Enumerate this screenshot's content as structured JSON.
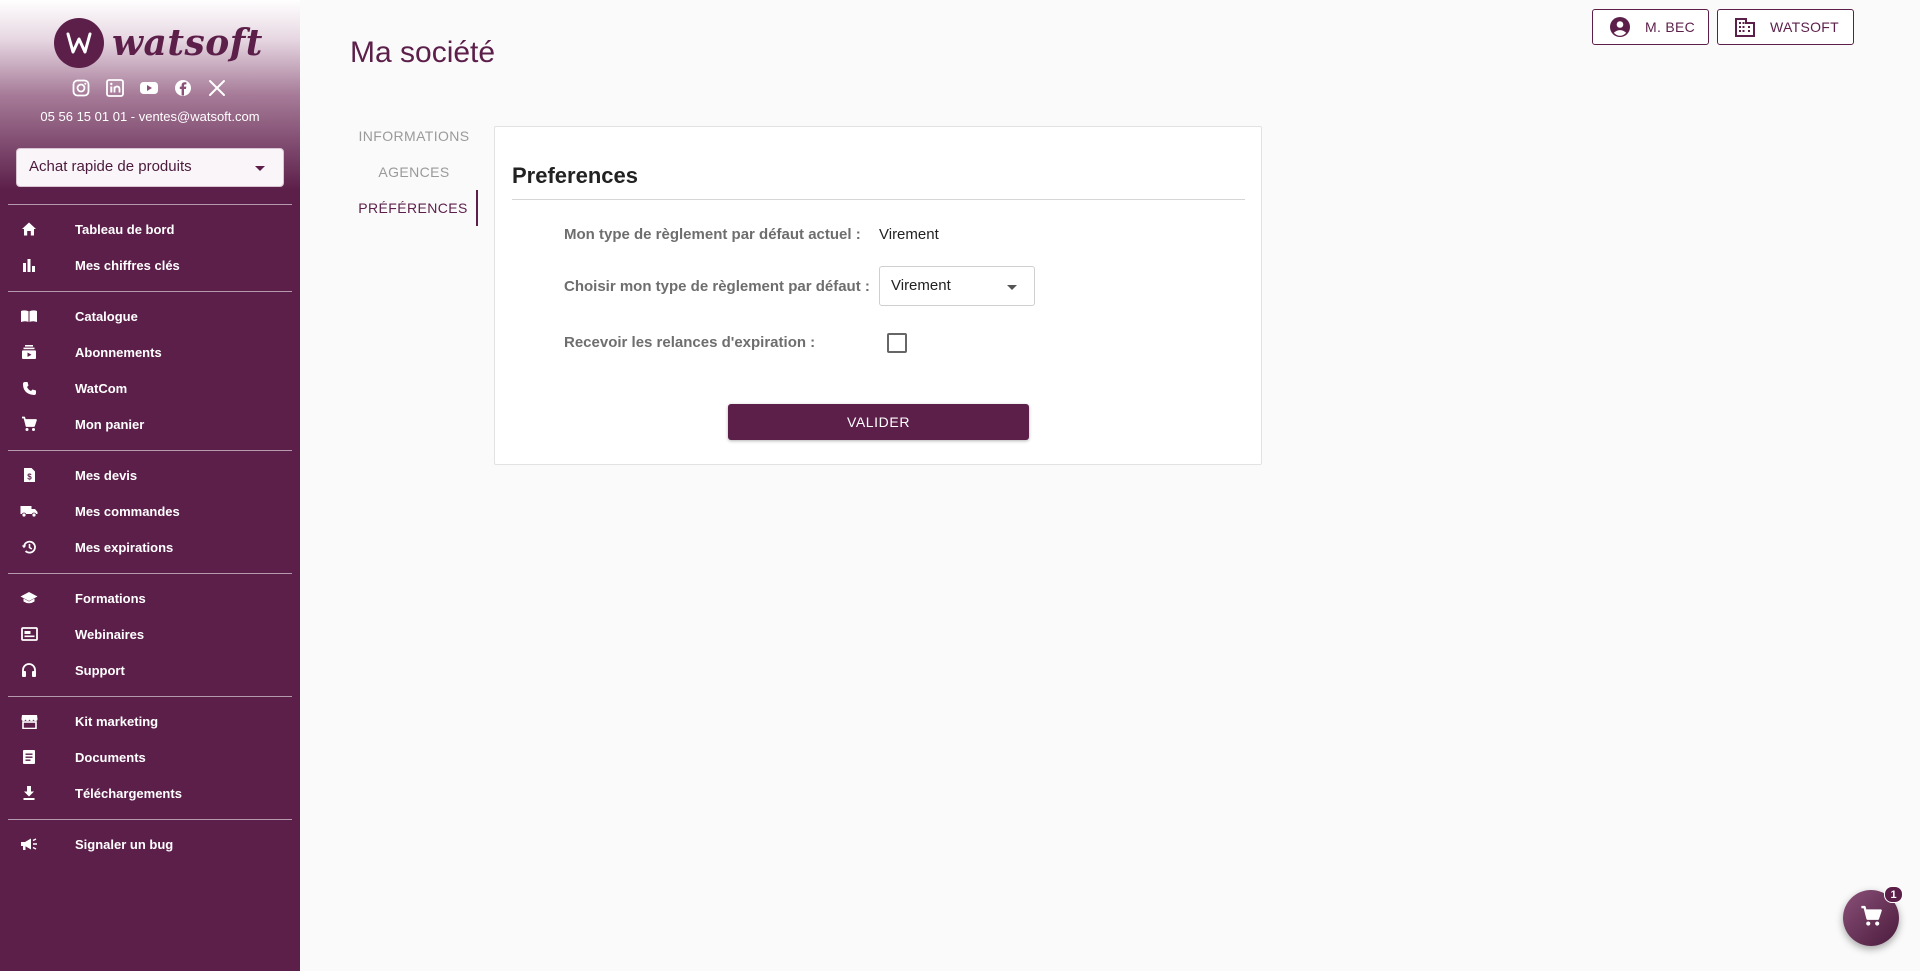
{
  "brand": {
    "name": "watsoft",
    "primary_color": "#5c1f4a"
  },
  "sidebar": {
    "socials": [
      "instagram-icon",
      "linkedin-icon",
      "youtube-icon",
      "facebook-icon",
      "x-icon"
    ],
    "contact": "05 56 15 01 01 - ventes@watsoft.com",
    "quick_buy": {
      "value": "Achat rapide de produits"
    },
    "items": [
      {
        "label": "Tableau de bord",
        "icon": "home-icon"
      },
      {
        "label": "Mes chiffres clés",
        "icon": "bar-chart-icon"
      },
      {
        "label": "Catalogue",
        "icon": "book-icon"
      },
      {
        "label": "Abonnements",
        "icon": "subscriptions-icon"
      },
      {
        "label": "WatCom",
        "icon": "phone-icon"
      },
      {
        "label": "Mon panier",
        "icon": "cart-icon"
      },
      {
        "label": "Mes devis",
        "icon": "quote-icon"
      },
      {
        "label": "Mes commandes",
        "icon": "truck-icon"
      },
      {
        "label": "Mes expirations",
        "icon": "history-icon"
      },
      {
        "label": "Formations",
        "icon": "school-icon"
      },
      {
        "label": "Webinaires",
        "icon": "webinar-icon"
      },
      {
        "label": "Support",
        "icon": "headset-icon"
      },
      {
        "label": "Kit marketing",
        "icon": "store-icon"
      },
      {
        "label": "Documents",
        "icon": "document-icon"
      },
      {
        "label": "Téléchargements",
        "icon": "download-icon"
      },
      {
        "label": "Signaler un bug",
        "icon": "megaphone-icon"
      }
    ]
  },
  "header": {
    "title": "Ma société",
    "user_button": "M. BEC",
    "company_button": "WATSOFT"
  },
  "tabs": [
    {
      "label": "INFORMATIONS",
      "active": false
    },
    {
      "label": "AGENCES",
      "active": false
    },
    {
      "label": "PRÉFÉRENCES",
      "active": true
    }
  ],
  "preferences": {
    "title": "Preferences",
    "current_payment_label": "Mon type de règlement par défaut actuel :",
    "current_payment_value": "Virement",
    "choose_payment_label": "Choisir mon type de règlement par défaut :",
    "choose_payment_value": "Virement",
    "reminders_label": "Recevoir les relances d'expiration :",
    "reminders_checked": false,
    "submit_label": "VALIDER"
  },
  "cart": {
    "count": "1"
  }
}
